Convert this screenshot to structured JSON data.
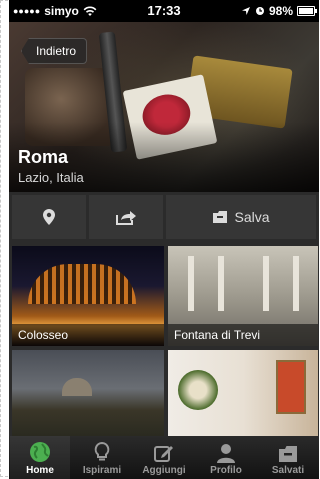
{
  "status_bar": {
    "carrier": "simyo",
    "time": "17:33",
    "battery": "98%",
    "battery_level": 0.98,
    "icons": [
      "signal-dots-icon",
      "wifi-icon",
      "location-arrow-icon",
      "alarm-icon",
      "battery-icon"
    ]
  },
  "header": {
    "back_label": "Indietro",
    "city": "Roma",
    "region": "Lazio, Italia"
  },
  "actions": {
    "location_icon": "map-pin-icon",
    "share_icon": "share-icon",
    "save_icon": "folder-save-icon",
    "save_label": "Salva"
  },
  "places": [
    {
      "label": "Colosseo"
    },
    {
      "label": "Fontana di Trevi"
    },
    {
      "label": ""
    },
    {
      "label": ""
    }
  ],
  "tabbar": {
    "items": [
      {
        "label": "Home",
        "icon": "globe-icon",
        "active": true
      },
      {
        "label": "Ispirami",
        "icon": "lightbulb-icon",
        "active": false
      },
      {
        "label": "Aggiungi",
        "icon": "edit-icon",
        "active": false
      },
      {
        "label": "Profilo",
        "icon": "person-icon",
        "active": false
      },
      {
        "label": "Salvati",
        "icon": "folder-icon",
        "active": false
      }
    ]
  },
  "colors": {
    "active_tab_icon": "#4caf50",
    "background": "#2b2b2b"
  }
}
